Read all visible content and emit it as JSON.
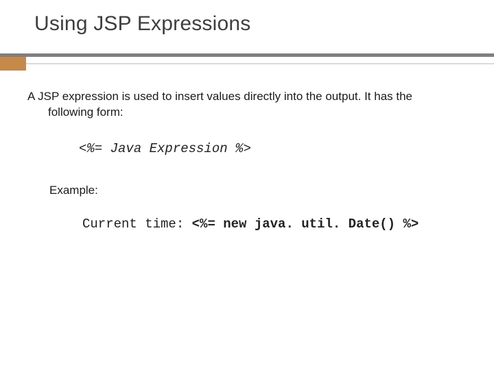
{
  "title": "Using JSP Expressions",
  "intro_line1": "A JSP expression is used to insert values directly into the output. It has the",
  "intro_line2": "following form:",
  "syntax_code": "<%= Java Expression %>",
  "example_label": "Example:",
  "example_prefix": "Current time: ",
  "example_code": "<%= new java. util. Date() %>"
}
